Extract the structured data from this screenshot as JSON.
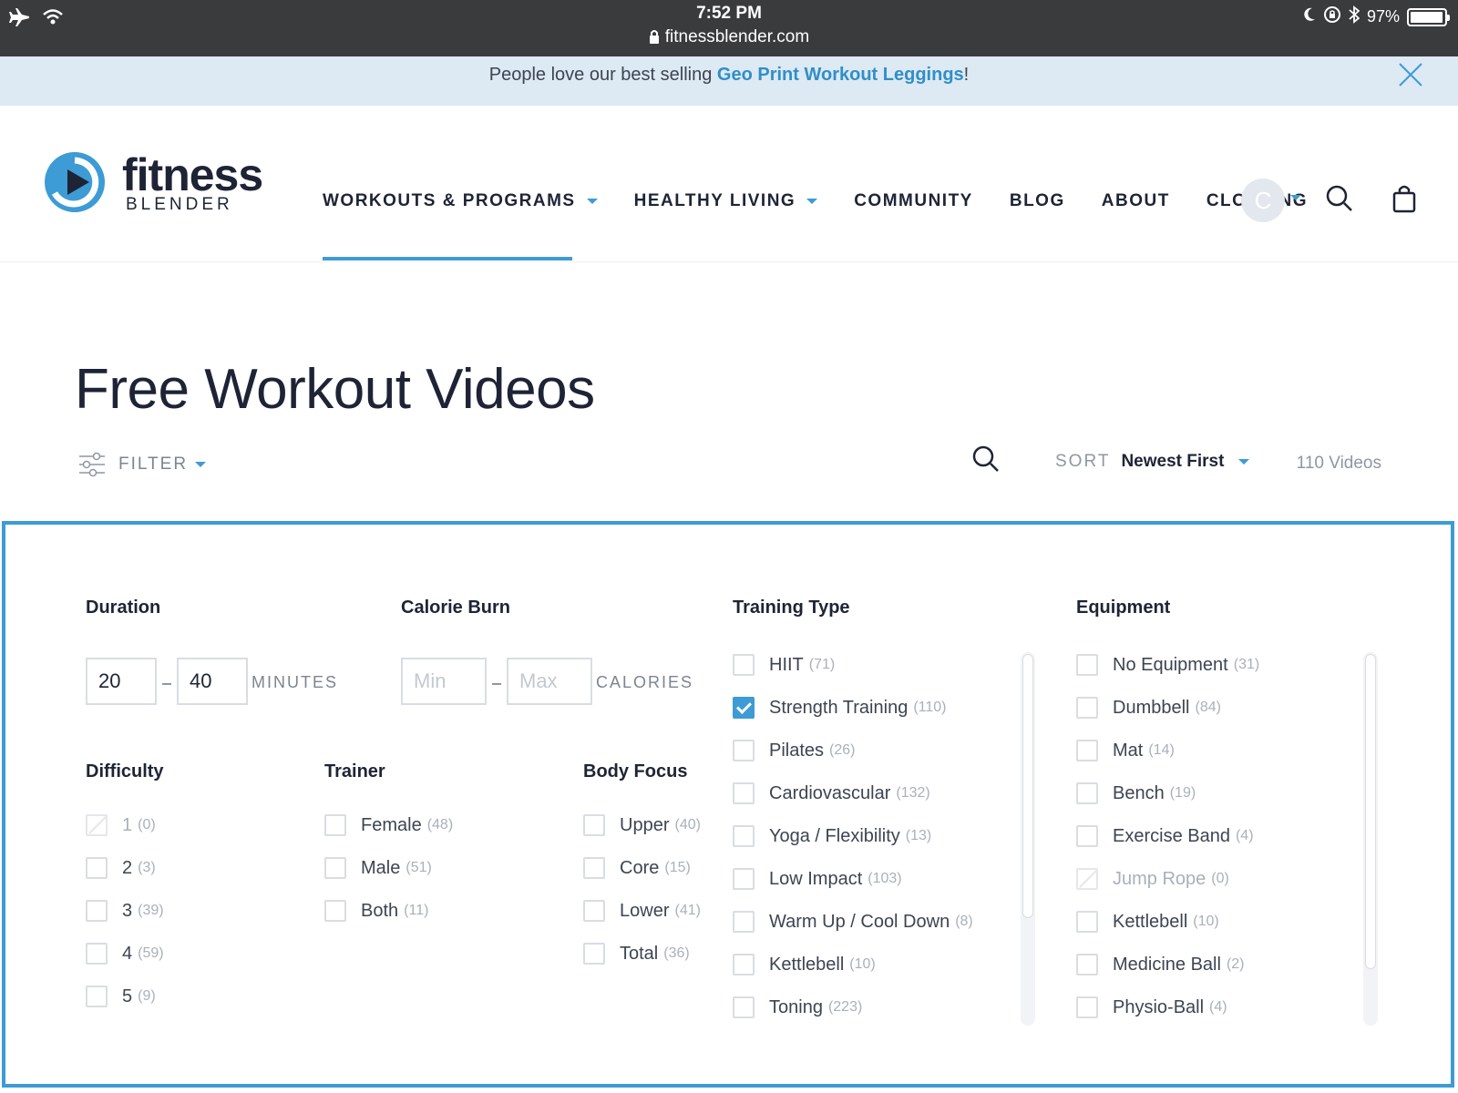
{
  "status_bar": {
    "time": "7:52 PM",
    "url": "fitnessblender.com",
    "battery": "97%",
    "battery_level": 0.97
  },
  "promo": {
    "text_before": "People love our best selling ",
    "link": "Geo Print Workout Leggings",
    "text_after": "!"
  },
  "logo": {
    "word1": "fitness",
    "word2": "BLENDER"
  },
  "nav": {
    "items": [
      {
        "label": "WORKOUTS & PROGRAMS",
        "has_caret": true,
        "active": true
      },
      {
        "label": "HEALTHY LIVING",
        "has_caret": true,
        "active": false
      },
      {
        "label": "COMMUNITY",
        "has_caret": false,
        "active": false
      },
      {
        "label": "BLOG",
        "has_caret": false,
        "active": false
      },
      {
        "label": "ABOUT",
        "has_caret": false,
        "active": false
      },
      {
        "label": "CLOTHING",
        "has_caret": false,
        "active": false
      }
    ],
    "avatar_initial": "C"
  },
  "page": {
    "title": "Free Workout Videos"
  },
  "toolbar": {
    "filter_label": "FILTER",
    "sort_label": "SORT",
    "sort_value": "Newest First",
    "count": "110 Videos"
  },
  "filters": {
    "duration": {
      "title": "Duration",
      "min": "20",
      "max": "40",
      "unit": "MINUTES"
    },
    "calorie": {
      "title": "Calorie Burn",
      "min_placeholder": "Min",
      "max_placeholder": "Max",
      "unit": "CALORIES"
    },
    "difficulty": {
      "title": "Difficulty",
      "options": [
        {
          "label": "1",
          "count": "(0)",
          "checked": false,
          "disabled": true
        },
        {
          "label": "2",
          "count": "(3)",
          "checked": false,
          "disabled": false
        },
        {
          "label": "3",
          "count": "(39)",
          "checked": false,
          "disabled": false
        },
        {
          "label": "4",
          "count": "(59)",
          "checked": false,
          "disabled": false
        },
        {
          "label": "5",
          "count": "(9)",
          "checked": false,
          "disabled": false
        }
      ]
    },
    "trainer": {
      "title": "Trainer",
      "options": [
        {
          "label": "Female",
          "count": "(48)",
          "checked": false,
          "disabled": false
        },
        {
          "label": "Male",
          "count": "(51)",
          "checked": false,
          "disabled": false
        },
        {
          "label": "Both",
          "count": "(11)",
          "checked": false,
          "disabled": false
        }
      ]
    },
    "body_focus": {
      "title": "Body Focus",
      "options": [
        {
          "label": "Upper",
          "count": "(40)",
          "checked": false,
          "disabled": false
        },
        {
          "label": "Core",
          "count": "(15)",
          "checked": false,
          "disabled": false
        },
        {
          "label": "Lower",
          "count": "(41)",
          "checked": false,
          "disabled": false
        },
        {
          "label": "Total",
          "count": "(36)",
          "checked": false,
          "disabled": false
        }
      ]
    },
    "training_type": {
      "title": "Training Type",
      "options": [
        {
          "label": "HIIT",
          "count": "(71)",
          "checked": false,
          "disabled": false
        },
        {
          "label": "Strength Training",
          "count": "(110)",
          "checked": true,
          "disabled": false
        },
        {
          "label": "Pilates",
          "count": "(26)",
          "checked": false,
          "disabled": false
        },
        {
          "label": "Cardiovascular",
          "count": "(132)",
          "checked": false,
          "disabled": false
        },
        {
          "label": "Yoga / Flexibility",
          "count": "(13)",
          "checked": false,
          "disabled": false
        },
        {
          "label": "Low Impact",
          "count": "(103)",
          "checked": false,
          "disabled": false
        },
        {
          "label": "Warm Up / Cool Down",
          "count": "(8)",
          "checked": false,
          "disabled": false
        },
        {
          "label": "Kettlebell",
          "count": "(10)",
          "checked": false,
          "disabled": false
        },
        {
          "label": "Toning",
          "count": "(223)",
          "checked": false,
          "disabled": false
        }
      ]
    },
    "equipment": {
      "title": "Equipment",
      "options": [
        {
          "label": "No Equipment",
          "count": "(31)",
          "checked": false,
          "disabled": false
        },
        {
          "label": "Dumbbell",
          "count": "(84)",
          "checked": false,
          "disabled": false
        },
        {
          "label": "Mat",
          "count": "(14)",
          "checked": false,
          "disabled": false
        },
        {
          "label": "Bench",
          "count": "(19)",
          "checked": false,
          "disabled": false
        },
        {
          "label": "Exercise Band",
          "count": "(4)",
          "checked": false,
          "disabled": false
        },
        {
          "label": "Jump Rope",
          "count": "(0)",
          "checked": false,
          "disabled": true
        },
        {
          "label": "Kettlebell",
          "count": "(10)",
          "checked": false,
          "disabled": false
        },
        {
          "label": "Medicine Ball",
          "count": "(2)",
          "checked": false,
          "disabled": false
        },
        {
          "label": "Physio-Ball",
          "count": "(4)",
          "checked": false,
          "disabled": false
        }
      ]
    }
  },
  "colors": {
    "accent": "#3d9bd5",
    "text": "#1e2436",
    "muted": "#8f96a3",
    "promo_bg": "#dde9f3",
    "statusbar_bg": "#3a3b3d"
  }
}
